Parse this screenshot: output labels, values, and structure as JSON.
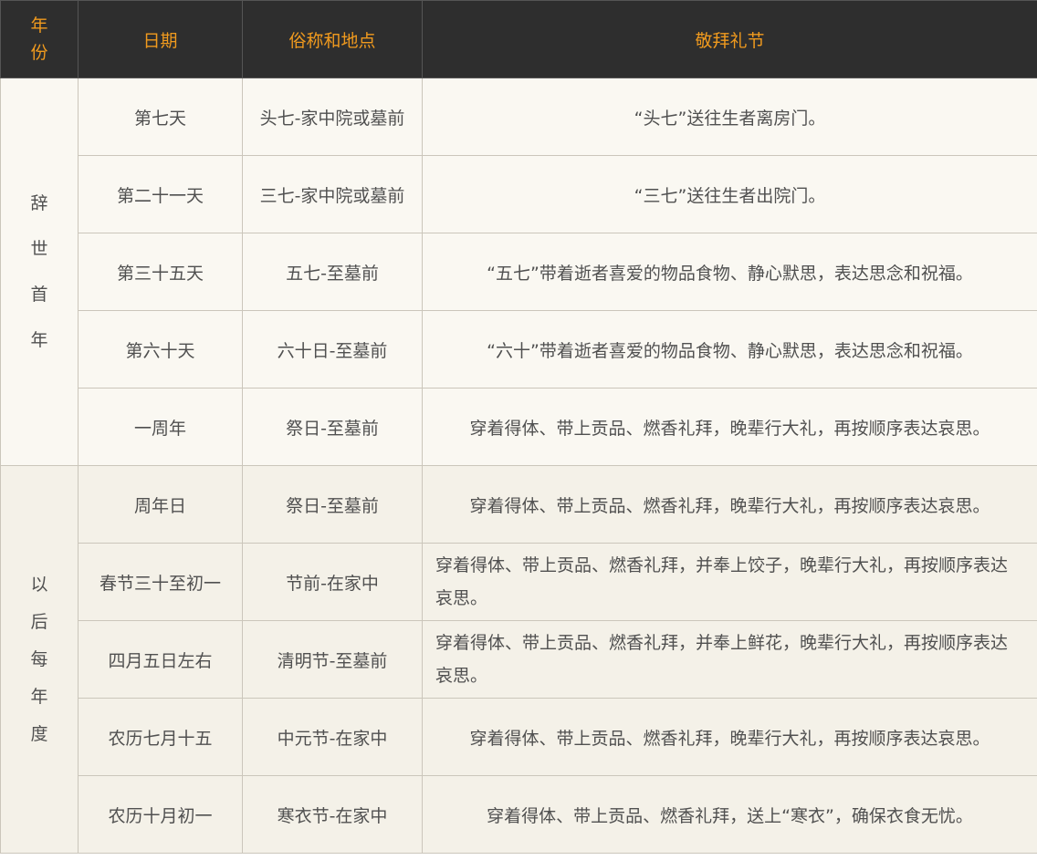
{
  "headers": {
    "year": [
      "年",
      "份"
    ],
    "date": "日期",
    "name_place": "俗称和地点",
    "ritual": "敬拜礼节"
  },
  "groups": [
    {
      "label_chars": [
        "辞",
        "世",
        "首",
        "年"
      ],
      "rows": [
        {
          "date": "第七天",
          "place": "头七-家中院或墓前",
          "ritual": "“头七”送往生者离房门。"
        },
        {
          "date": "第二十一天",
          "place": "三七-家中院或墓前",
          "ritual": "“三七”送往生者出院门。"
        },
        {
          "date": "第三十五天",
          "place": "五七-至墓前",
          "ritual": "“五七”带着逝者喜爱的物品食物、静心默思，表达思念和祝福。"
        },
        {
          "date": "第六十天",
          "place": "六十日-至墓前",
          "ritual": "“六十”带着逝者喜爱的物品食物、静心默思，表达思念和祝福。"
        },
        {
          "date": "一周年",
          "place": "祭日-至墓前",
          "ritual": "穿着得体、带上贡品、燃香礼拜，晚辈行大礼，再按顺序表达哀思。"
        }
      ]
    },
    {
      "label_chars": [
        "以",
        "后",
        "每",
        "年",
        "度"
      ],
      "rows": [
        {
          "date": "周年日",
          "place": "祭日-至墓前",
          "ritual": "穿着得体、带上贡品、燃香礼拜，晚辈行大礼，再按顺序表达哀思。"
        },
        {
          "date": "春节三十至初一",
          "place": "节前-在家中",
          "ritual": "穿着得体、带上贡品、燃香礼拜，并奉上饺子，晚辈行大礼，再按顺序表达哀思。"
        },
        {
          "date": "四月五日左右",
          "place": "清明节-至墓前",
          "ritual": "穿着得体、带上贡品、燃香礼拜，并奉上鲜花，晚辈行大礼，再按顺序表达哀思。"
        },
        {
          "date": "农历七月十五",
          "place": "中元节-在家中",
          "ritual": "穿着得体、带上贡品、燃香礼拜，晚辈行大礼，再按顺序表达哀思。"
        },
        {
          "date": "农历十月初一",
          "place": "寒衣节-在家中",
          "ritual": "穿着得体、带上贡品、燃香礼拜，送上“寒衣”，确保衣食无忧。"
        }
      ]
    }
  ]
}
